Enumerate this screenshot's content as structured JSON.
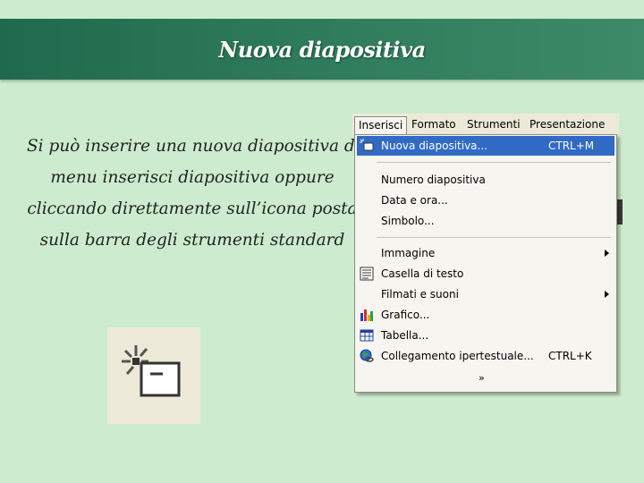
{
  "slide": {
    "title": "Nuova diapositiva",
    "body_lines": [
      "Si può inserire una nuova diapositiva dal",
      "menu inserisci diapositiva oppure",
      "cliccando direttamente sull’icona posta",
      "sulla barra degli strumenti standard"
    ]
  },
  "menubar": {
    "items": [
      {
        "label": "Inserisci",
        "state": "open"
      },
      {
        "label": "Formato"
      },
      {
        "label": "Strumenti"
      },
      {
        "label": "Presentazione"
      }
    ]
  },
  "insert_menu": {
    "items": [
      {
        "label": "Nuova diapositiva...",
        "shortcut": "CTRL+M",
        "icon": "new-slide-icon",
        "highlighted": true
      },
      {
        "label": "Numero diapositiva"
      },
      {
        "label": "Data e ora..."
      },
      {
        "label": "Simbolo..."
      },
      {
        "label": "Immagine",
        "submenu": true
      },
      {
        "label": "Casella di testo",
        "icon": "text-box-icon"
      },
      {
        "label": "Filmati e suoni",
        "submenu": true
      },
      {
        "label": "Grafico...",
        "icon": "chart-icon"
      },
      {
        "label": "Tabella...",
        "icon": "table-icon"
      },
      {
        "label": "Collegamento ipertestuale...",
        "shortcut": "CTRL+K",
        "icon": "hyperlink-globe-icon"
      }
    ],
    "expand_glyph": "»"
  },
  "toolbar_icon": {
    "name": "new-slide-icon"
  },
  "colors": {
    "background": "#cdeccf",
    "title_bar": "#2f7c5c",
    "highlight": "#316ac5",
    "menu_bg": "#f6f5f0"
  }
}
